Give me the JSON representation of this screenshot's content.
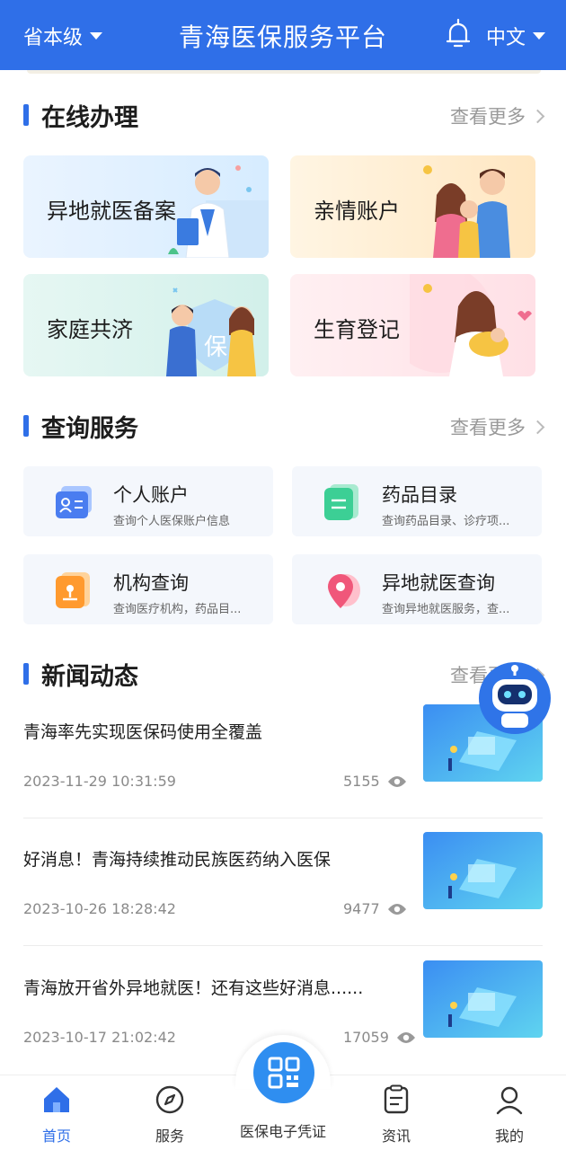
{
  "header": {
    "region": "省本级",
    "title": "青海医保服务平台",
    "language": "中文"
  },
  "online": {
    "title": "在线办理",
    "more": "查看更多",
    "cards": [
      {
        "label": "异地就医备案"
      },
      {
        "label": "亲情账户"
      },
      {
        "label": "家庭共济"
      },
      {
        "label": "生育登记"
      }
    ]
  },
  "query": {
    "title": "查询服务",
    "more": "查看更多",
    "cards": [
      {
        "title": "个人账户",
        "desc": "查询个人医保账户信息",
        "icon": "id-card-icon"
      },
      {
        "title": "药品目录",
        "desc": "查询药品目录、诊疗项...",
        "icon": "list-document-icon"
      },
      {
        "title": "机构查询",
        "desc": "查询医疗机构，药品目...",
        "icon": "institution-icon"
      },
      {
        "title": "异地就医查询",
        "desc": "查询异地就医服务，查...",
        "icon": "location-pin-icon"
      }
    ]
  },
  "news": {
    "title": "新闻动态",
    "more": "查看更多",
    "items": [
      {
        "title": "青海率先实现医保码使用全覆盖",
        "date": "2023-11-29 10:31:59",
        "views": "5155"
      },
      {
        "title": "好消息！青海持续推动民族医药纳入医保",
        "date": "2023-10-26 18:28:42",
        "views": "9477"
      },
      {
        "title": "青海放开省外异地就医！还有这些好消息......",
        "date": "2023-10-17 21:02:42",
        "views": "17059"
      }
    ]
  },
  "nav": {
    "home": "首页",
    "service": "服务",
    "center": "医保电子凭证",
    "news": "资讯",
    "mine": "我的"
  },
  "colors": {
    "primary": "#2f6fe8",
    "center_button": "#2f8ef0"
  }
}
